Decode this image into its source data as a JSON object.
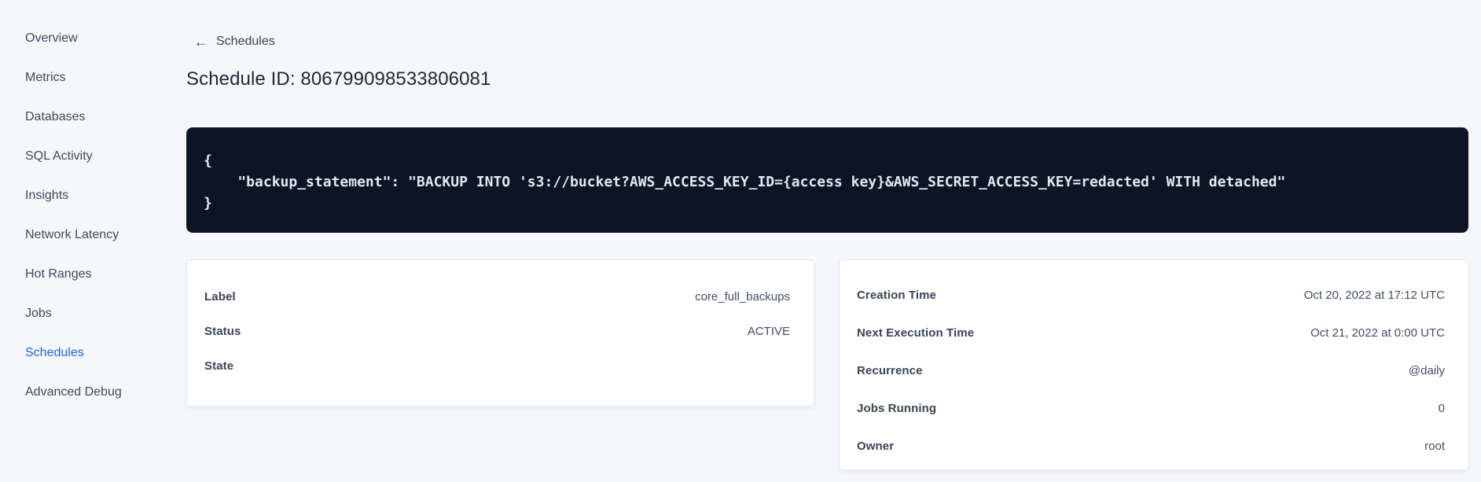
{
  "sidebar": {
    "items": [
      {
        "label": "Overview",
        "active": false
      },
      {
        "label": "Metrics",
        "active": false
      },
      {
        "label": "Databases",
        "active": false
      },
      {
        "label": "SQL Activity",
        "active": false
      },
      {
        "label": "Insights",
        "active": false
      },
      {
        "label": "Network Latency",
        "active": false
      },
      {
        "label": "Hot Ranges",
        "active": false
      },
      {
        "label": "Jobs",
        "active": false
      },
      {
        "label": "Schedules",
        "active": true
      },
      {
        "label": "Advanced Debug",
        "active": false
      }
    ]
  },
  "header": {
    "back_icon": "←",
    "back_label": "Schedules",
    "title": "Schedule ID: 806799098533806081"
  },
  "code_block": {
    "lines": [
      "{",
      "    \"backup_statement\": \"BACKUP INTO 's3://bucket?AWS_ACCESS_KEY_ID={access key}&AWS_SECRET_ACCESS_KEY=redacted' WITH detached\"",
      "}"
    ]
  },
  "cards": {
    "left": {
      "rows": [
        {
          "label": "Label",
          "value": "core_full_backups"
        },
        {
          "label": "Status",
          "value": "ACTIVE"
        },
        {
          "label": "State",
          "value": ""
        }
      ]
    },
    "right": {
      "rows": [
        {
          "label": "Creation Time",
          "value": "Oct 20, 2022 at 17:12 UTC"
        },
        {
          "label": "Next Execution Time",
          "value": "Oct 21, 2022 at 0:00 UTC"
        },
        {
          "label": "Recurrence",
          "value": "@daily"
        },
        {
          "label": "Jobs Running",
          "value": "0"
        },
        {
          "label": "Owner",
          "value": "root"
        }
      ]
    }
  },
  "colors": {
    "accent_blue": "#2161f3",
    "page_background": "#f5f7fa",
    "code_block_background": "#0d1424",
    "code_text": "#e3e8ef",
    "sidebar_text": "#3e4a5e",
    "label_text": "#394455"
  }
}
